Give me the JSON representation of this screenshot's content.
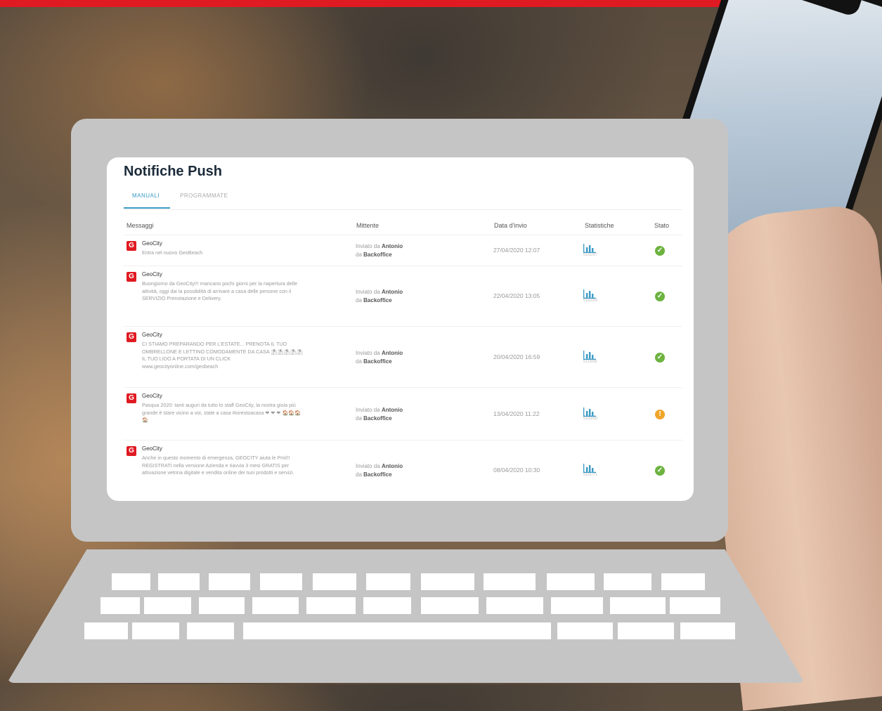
{
  "colors": {
    "brand": "#e01a22",
    "accent": "#3a9ac4",
    "ok": "#6cb33f",
    "warn": "#f0a52a"
  },
  "app": {
    "title": "Notifiche Push",
    "tabs": [
      {
        "label": "MANUALI",
        "active": true
      },
      {
        "label": "PROGRAMMATE",
        "active": false
      }
    ],
    "columns": {
      "messages": "Messaggi",
      "sender": "Mittente",
      "date": "Data d'invio",
      "stats": "Statistiche",
      "status": "Stato"
    },
    "rows": [
      {
        "app": "GeoCity",
        "message": "Entra nel nuovo GeoBeach",
        "sent_by_prefix": "Inviato da",
        "sent_by_name": "Antonio",
        "via_prefix": "da",
        "via": "Backoffice",
        "date": "27/04/2020 12:07",
        "stats_value": "5101/67",
        "status_icon": "check-icon",
        "status": "ok"
      },
      {
        "app": "GeoCity",
        "message": "Buongiorno da GeoCity!!! mancano pochi giorni per la riapertura delle attività, oggi dai la possibilità di arrivare a casa delle persone con il SERVIZIO Prenotazione e Delivery.",
        "sent_by_prefix": "Inviato da",
        "sent_by_name": "Antonio",
        "via_prefix": "da",
        "via": "Backoffice",
        "date": "22/04/2020 13:05",
        "stats_value": "5102/93",
        "status_icon": "check-icon",
        "status": "ok"
      },
      {
        "app": "GeoCity",
        "message": "CI STIAMO PREPARANDO PER L'ESTATE... PRENOTA IL TUO OMBRELLONE E LETTINO COMODAMENTE DA CASA ⛱⛱⛱⛱⛱ IL TUO LIDO A PORTATA DI UN CLICK www.geocityonline.com/geobeach",
        "sent_by_prefix": "Inviato da",
        "sent_by_name": "Antonio",
        "via_prefix": "da",
        "via": "Backoffice",
        "date": "20/04/2020 16:59",
        "stats_value": "5110/58",
        "status_icon": "check-icon",
        "status": "ok"
      },
      {
        "app": "GeoCity",
        "message": "Pasqua 2020: tanti auguri da tutto lo staff GeoCity, la nostra gioia più grande è stare vicino a voi, state a casa #iorestoacasa ❤ ❤ ❤ 🏠🏠🏠🏠",
        "sent_by_prefix": "Inviato da",
        "sent_by_name": "Antonio",
        "via_prefix": "da",
        "via": "Backoffice",
        "date": "13/04/2020 11:22",
        "stats_value": "5103/68",
        "status_icon": "exclamation-icon",
        "status": "warn"
      },
      {
        "app": "GeoCity",
        "message": "Anche in questo momento di emergenza, GEOCITY aiuta le Pmi!!! REGISTRATI nella versione Azienda e riavvia 3 mesi GRATIS per attivazione vetrina digitale e vendita online dei tuoi prodotti e servizi.",
        "sent_by_prefix": "Inviato da",
        "sent_by_name": "Antonio",
        "via_prefix": "da",
        "via": "Backoffice",
        "date": "08/04/2020 10:30",
        "stats_value": "5101/71",
        "status_icon": "check-icon",
        "status": "ok"
      }
    ]
  }
}
